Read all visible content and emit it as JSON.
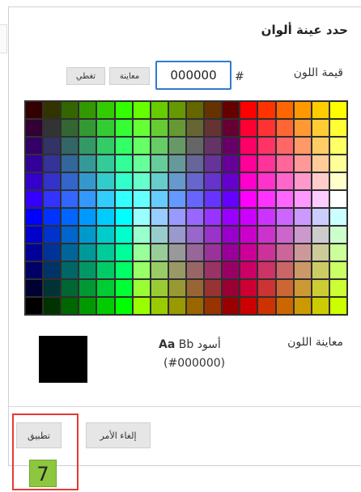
{
  "dialog": {
    "title": "حدد عينة ألوان",
    "color_value_label": "قيمة اللون",
    "hash_symbol": "#",
    "hex_value": "000000",
    "preview_button": "معاينة",
    "cover_button": "تغطي",
    "preview_label": "معاينة اللون",
    "sample_aa": "Aa",
    "sample_bb": "Bb",
    "sample_color_name": "أسود",
    "sample_hex": "(#000000)",
    "swatch_color": "#000000",
    "apply_button": "تطبيق",
    "cancel_button": "إلغاء الأمر"
  },
  "annotation": {
    "step_number": "7",
    "highlight_color": "#e53935",
    "badge_color": "#8dc63f"
  },
  "palette": {
    "rows": 12,
    "columns": 18,
    "colors": [
      [
        "#330000",
        "#333300",
        "#336600",
        "#339900",
        "#33cc00",
        "#33ff00",
        "#66ff00",
        "#66cc00",
        "#669900",
        "#666600",
        "#663300",
        "#660000",
        "#ff0000",
        "#ff3300",
        "#ff6600",
        "#ff9900",
        "#ffcc00",
        "#ffff00"
      ],
      [
        "#330033",
        "#333333",
        "#336633",
        "#339933",
        "#33cc33",
        "#33ff33",
        "#66ff33",
        "#66cc33",
        "#669933",
        "#666633",
        "#663333",
        "#660033",
        "#ff0033",
        "#ff3333",
        "#ff6633",
        "#ff9933",
        "#ffcc33",
        "#ffff33"
      ],
      [
        "#330066",
        "#333366",
        "#336666",
        "#339966",
        "#33cc66",
        "#33ff66",
        "#66ff66",
        "#66cc66",
        "#669966",
        "#666666",
        "#663366",
        "#660066",
        "#ff0066",
        "#ff3366",
        "#ff6666",
        "#ff9966",
        "#ffcc66",
        "#ffff66"
      ],
      [
        "#330099",
        "#333399",
        "#336699",
        "#339999",
        "#33cc99",
        "#33ff99",
        "#66ff99",
        "#66cc99",
        "#669999",
        "#666699",
        "#663399",
        "#660099",
        "#ff0099",
        "#ff3399",
        "#ff6699",
        "#ff9999",
        "#ffcc99",
        "#ffff99"
      ],
      [
        "#3300cc",
        "#3333cc",
        "#3366cc",
        "#3399cc",
        "#33cccc",
        "#33ffcc",
        "#66ffcc",
        "#66cccc",
        "#6699cc",
        "#6666cc",
        "#6633cc",
        "#6600cc",
        "#ff00cc",
        "#ff33cc",
        "#ff66cc",
        "#ff99cc",
        "#ffcccc",
        "#ffffcc"
      ],
      [
        "#3300ff",
        "#3333ff",
        "#3366ff",
        "#3399ff",
        "#33ccff",
        "#33ffff",
        "#66ffff",
        "#66ccff",
        "#6699ff",
        "#6666ff",
        "#6633ff",
        "#6600ff",
        "#ff00ff",
        "#ff33ff",
        "#ff66ff",
        "#ff99ff",
        "#ffccff",
        "#ffffff"
      ],
      [
        "#0000ff",
        "#0033ff",
        "#0066ff",
        "#0099ff",
        "#00ccff",
        "#00ffff",
        "#99ffff",
        "#99ccff",
        "#9999ff",
        "#9966ff",
        "#9933ff",
        "#9900ff",
        "#cc00ff",
        "#cc33ff",
        "#cc66ff",
        "#cc99ff",
        "#ccccff",
        "#ccffff"
      ],
      [
        "#0000cc",
        "#0033cc",
        "#0066cc",
        "#0099cc",
        "#00cccc",
        "#00ffcc",
        "#99ffcc",
        "#99cccc",
        "#9999cc",
        "#9966cc",
        "#9933cc",
        "#9900cc",
        "#cc00cc",
        "#cc33cc",
        "#cc66cc",
        "#cc99cc",
        "#cccccc",
        "#ccffcc"
      ],
      [
        "#000099",
        "#003399",
        "#006699",
        "#009999",
        "#00cc99",
        "#00ff99",
        "#99ff99",
        "#99cc99",
        "#999999",
        "#996699",
        "#993399",
        "#990099",
        "#cc0099",
        "#cc3399",
        "#cc6699",
        "#cc9999",
        "#cccc99",
        "#ccff99"
      ],
      [
        "#000066",
        "#003366",
        "#006666",
        "#009966",
        "#00cc66",
        "#00ff66",
        "#99ff66",
        "#99cc66",
        "#999966",
        "#996666",
        "#993366",
        "#990066",
        "#cc0066",
        "#cc3366",
        "#cc6666",
        "#cc9966",
        "#cccc66",
        "#ccff66"
      ],
      [
        "#000033",
        "#003333",
        "#006633",
        "#009933",
        "#00cc33",
        "#00ff33",
        "#99ff33",
        "#99cc33",
        "#999933",
        "#996633",
        "#993333",
        "#990033",
        "#cc0033",
        "#cc3333",
        "#cc6633",
        "#cc9933",
        "#cccc33",
        "#ccff33"
      ],
      [
        "#000000",
        "#003300",
        "#006600",
        "#009900",
        "#00cc00",
        "#00ff00",
        "#99ff00",
        "#99cc00",
        "#999900",
        "#996600",
        "#993300",
        "#990000",
        "#cc0000",
        "#cc3300",
        "#cc6600",
        "#cc9900",
        "#cccc00",
        "#ccff00"
      ]
    ]
  }
}
